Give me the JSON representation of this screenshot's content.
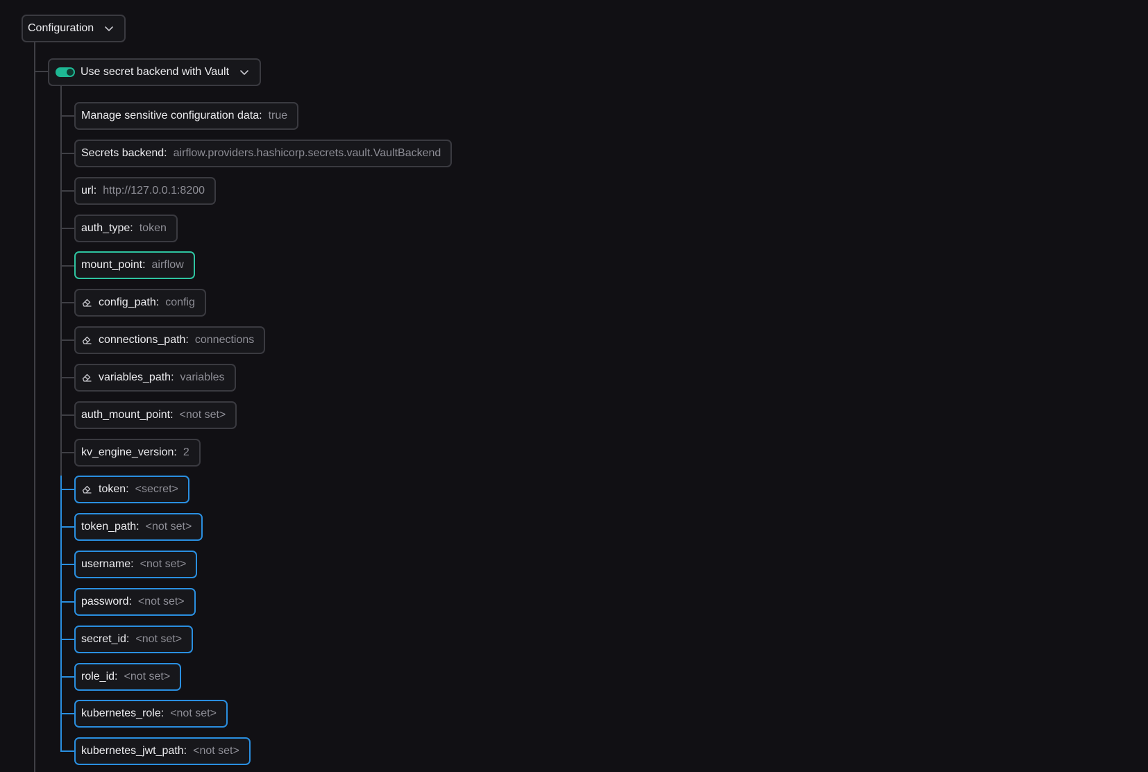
{
  "root": {
    "label": "Configuration"
  },
  "group": {
    "label": "Use secret backend with Vault",
    "enabled": true
  },
  "settings": [
    {
      "label": "Manage sensitive configuration data:",
      "value": "true"
    },
    {
      "label": "Secrets backend:",
      "value": "airflow.providers.hashicorp.secrets.vault.VaultBackend"
    },
    {
      "label": "url:",
      "value": "http://127.0.0.1:8200"
    },
    {
      "label": "auth_type:",
      "value": "token"
    },
    {
      "label": "mount_point:",
      "value": "airflow"
    },
    {
      "label": "config_path:",
      "value": "config"
    },
    {
      "label": "connections_path:",
      "value": "connections"
    },
    {
      "label": "variables_path:",
      "value": "variables"
    },
    {
      "label": "auth_mount_point:",
      "value": "<not set>"
    },
    {
      "label": "kv_engine_version:",
      "value": "2"
    },
    {
      "label": "token:",
      "value": "<secret>"
    },
    {
      "label": "token_path:",
      "value": "<not set>"
    },
    {
      "label": "username:",
      "value": "<not set>"
    },
    {
      "label": "password:",
      "value": "<not set>"
    },
    {
      "label": "secret_id:",
      "value": "<not set>"
    },
    {
      "label": "role_id:",
      "value": "<not set>"
    },
    {
      "label": "kubernetes_role:",
      "value": "<not set>"
    },
    {
      "label": "kubernetes_jwt_path:",
      "value": "<not set>"
    }
  ],
  "icons": {
    "chevron": "chevron-down-icon",
    "eraser": "eraser-icon",
    "toggle": "toggle-switch"
  },
  "colors": {
    "background": "#111014",
    "border": "#3a3a40",
    "selected": "#2ec4a0",
    "highlight": "#2a8fe0"
  }
}
